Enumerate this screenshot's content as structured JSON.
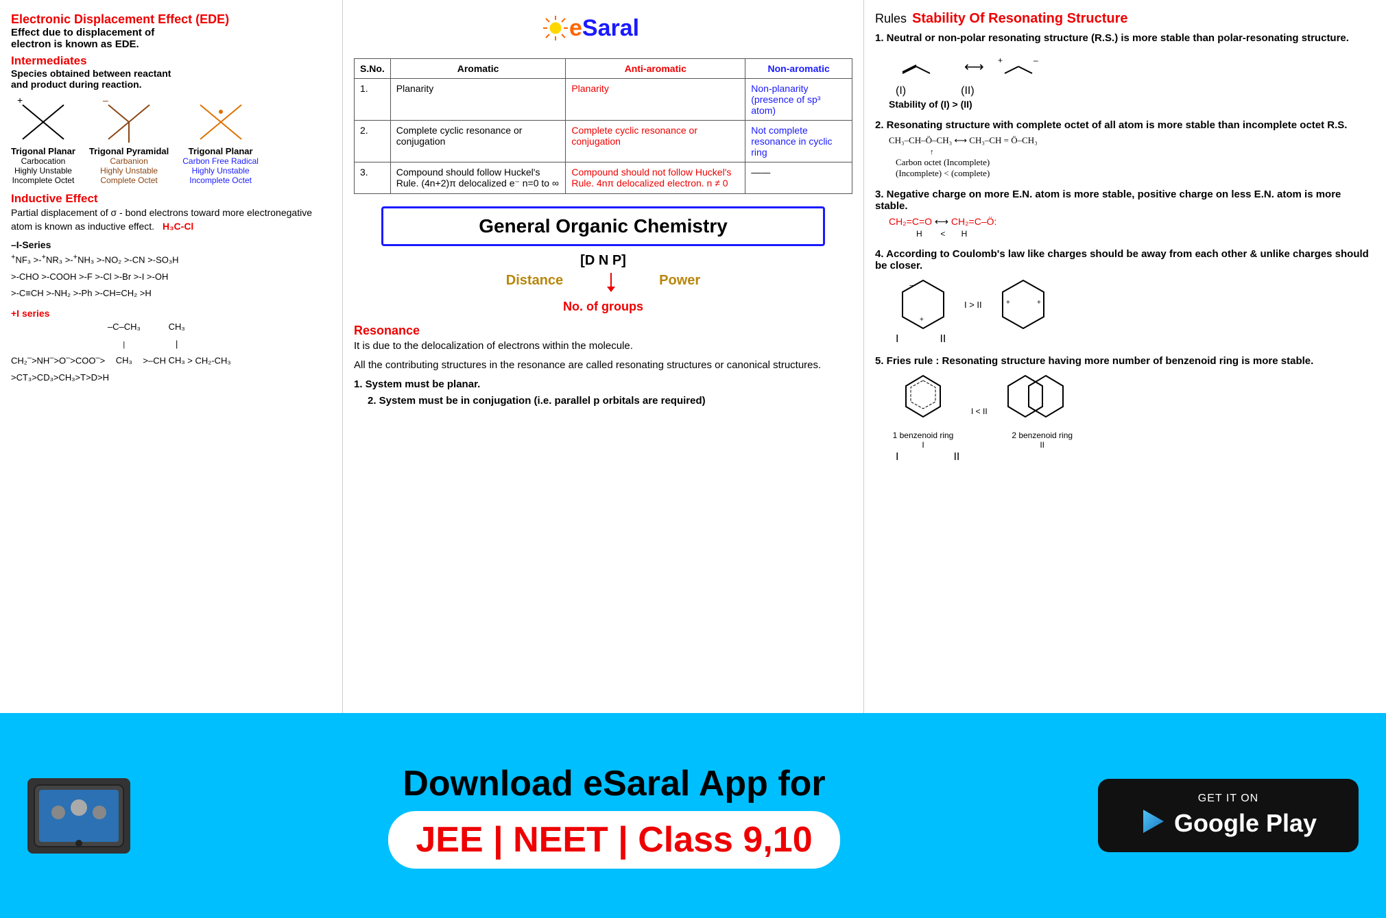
{
  "header": {
    "logo": "eSaral",
    "logo_e": "e",
    "logo_saral": "Saral"
  },
  "left": {
    "ede_title": "Electronic Displacement Effect (EDE)",
    "ede_body": "Effect due to displacement of electron is known as EDE.",
    "intermediates_title": "Intermediates",
    "intermediates_body": "Species obtained between reactant and product during reaction.",
    "structures": [
      {
        "name": "Trigonal Planar",
        "type": "Carbocation",
        "stability": "Highly Unstable",
        "octet": "Incomplete Octet",
        "color": "black"
      },
      {
        "name": "Trigonal Pyramidal",
        "type": "Carbanion",
        "stability": "Highly Unstable",
        "octet": "Complete Octet",
        "color": "brown"
      },
      {
        "name": "Trigonal Planar",
        "type": "Carbon Free Radical",
        "stability": "Highly Unstable",
        "octet": "Incomplete Octet",
        "color": "orange"
      }
    ],
    "inductive_title": "Inductive Effect",
    "inductive_body": "Partial displacement of σ - bond electrons toward more electronegative atom is known as inductive effect.",
    "inductive_formula": "H₃C-Cl",
    "iseries_title": "–I-Series",
    "iseries_lines": [
      "NF₃ >-NR₃ >-NH₃ >-NO₂ >-CN >-SO₃H",
      ">-CHO >-COOH >-F >-Cl >-Br >-I >-OH",
      ">-C≡CH >-NH₂ >-Ph >-CH=CH₂ >H"
    ],
    "iplus_title": "+I series",
    "iplus_line": "CH₂⁻>NH⁻>O⁻>COO⁻> -C(CH₃)₃ >-CH(CH₃)₂ > CH₂-CH₃",
    "iplus_line2": ">CT₃>CD₃>CH₃>T>D>H"
  },
  "middle": {
    "table_header": [
      "S.No.",
      "Aromatic",
      "Anti-aromatic",
      "Non-aromatic"
    ],
    "table_rows": [
      {
        "no": "1.",
        "aromatic": "Planarity",
        "antiaromatic": "Planarity",
        "nonaromatic": "Non-planarity (presence of sp³ atom)"
      },
      {
        "no": "2.",
        "aromatic": "Complete cyclic resonance or conjugation",
        "antiaromatic": "Complete cyclic resonance or conjugation",
        "nonaromatic": "Not complete resonance in cyclic ring"
      },
      {
        "no": "3.",
        "aromatic": "Compound should follow Huckel's Rule. (4n+2)π delocalized e⁻ n=0 to ∞",
        "antiaromatic": "Compound should not follow Huckel's Rule. 4nπ delocalized electron. n≠0",
        "nonaromatic": "——"
      }
    ],
    "goc_title": "General Organic Chemistry",
    "dnp_label": "[D N P]",
    "dnp_distance": "Distance",
    "dnp_power": "Power",
    "dnp_groups": "No. of groups",
    "resonance_title": "Resonance",
    "resonance_body": "It is due to the delocalization of electrons within the molecule.",
    "resonance_body2": "All the contributing structures in the resonance are called resonating structures or canonical structures.",
    "resonance_rule1": "1. System must be planar.",
    "resonance_rule2": "2. System must be in conjugation (i.e. parallel p orbitals are required)"
  },
  "right": {
    "rules_label": "Rules",
    "stability_title": "Stability Of Resonating Structure",
    "rule1_title": "1. Neutral or non-polar resonating structure (R.S.) is more stable than polar-resonating structure.",
    "rule1_stability": "Stability of (I) > (II)",
    "rule2_title": "2. Resonating structure with complete octet of all atom is more stable than incomplete octet R.S.",
    "rule2_note": "Carbon octet (Incomplete)\n(Incomplete) < (complete)",
    "rule3_title": "3. Negative charge on more E.N. atom is more stable, positive charge on less E.N. atom is more stable.",
    "rule4_title": "4. According to Coulomb's law like charges should be away from each other & unlike charges should be closer.",
    "rule4_note": "I > II",
    "rule5_title": "5. Fries rule : Resonating structure having more number of benzenoid ring is more stable.",
    "rule5_note1": "1 benzenoid ring",
    "rule5_note2": "2 benzenoid ring",
    "rule5_ineq": "I < II",
    "label_I": "I",
    "label_II": "II"
  },
  "footer": {
    "download_text": "Download eSaral App for",
    "jee_text": "JEE | NEET | Class 9,10",
    "get_it_on": "GET IT ON",
    "google_play": "Google Play"
  }
}
